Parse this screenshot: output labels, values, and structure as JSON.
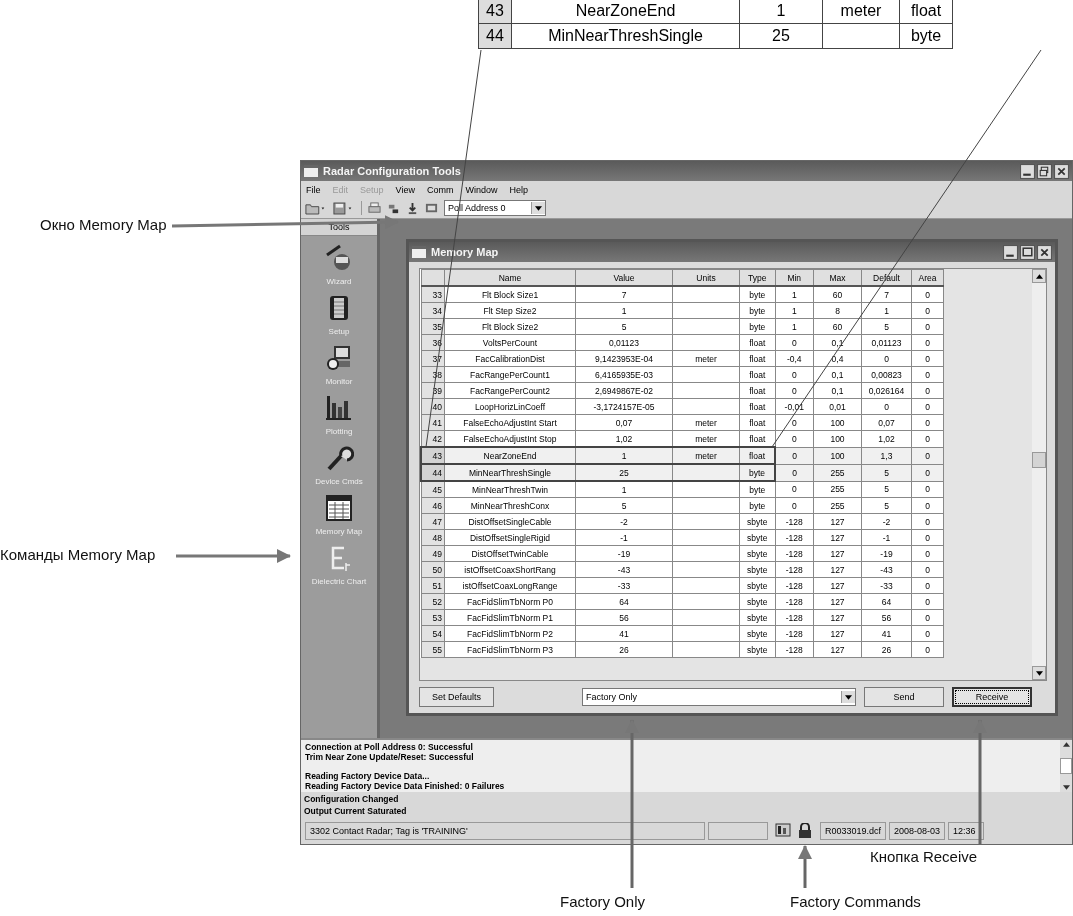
{
  "callout_table": {
    "rows": [
      {
        "cells": [
          "43",
          "NearZoneEnd",
          "1",
          "meter",
          "float"
        ]
      },
      {
        "cells": [
          "44",
          "MinNearThreshSingle",
          "25",
          "",
          "byte"
        ]
      }
    ]
  },
  "annotations": [
    {
      "text": "Окно Memory Map"
    },
    {
      "text": "Команды Memory Map"
    },
    {
      "text": "Factory Only"
    },
    {
      "text": "Factory Commands"
    },
    {
      "text": "Кнопка Receive"
    }
  ],
  "window": {
    "title": "Radar Configuration Tools",
    "menu": [
      {
        "label": "File",
        "disabled": false
      },
      {
        "label": "Edit",
        "disabled": true
      },
      {
        "label": "Setup",
        "disabled": true
      },
      {
        "label": "View",
        "disabled": false
      },
      {
        "label": "Comm",
        "disabled": false
      },
      {
        "label": "Window",
        "disabled": false
      },
      {
        "label": "Help",
        "disabled": false
      }
    ],
    "toolbar": {
      "poll_address": "Poll Address 0"
    },
    "sidebar": {
      "header": "Tools",
      "items": [
        {
          "label": "Wizard",
          "kind": "wizard"
        },
        {
          "label": "Setup",
          "kind": "setup"
        },
        {
          "label": "Monitor",
          "kind": "monitor"
        },
        {
          "label": "Plotting",
          "kind": "plotting"
        },
        {
          "label": "Device Cmds",
          "kind": "device"
        },
        {
          "label": "Memory Map",
          "kind": "memory"
        },
        {
          "label": "Dielectric Chart",
          "kind": "dielectric"
        }
      ]
    },
    "memory_map": {
      "title": "Memory Map",
      "columns": [
        "",
        "Name",
        "Value",
        "Units",
        "Type",
        "Min",
        "Max",
        "Default",
        "Area"
      ],
      "rows": [
        {
          "cells": [
            "33",
            "Flt Block Size1",
            "7",
            "",
            "byte",
            "1",
            "60",
            "7",
            "0"
          ],
          "highlighted": false
        },
        {
          "cells": [
            "34",
            "Flt Step Size2",
            "1",
            "",
            "byte",
            "1",
            "8",
            "1",
            "0"
          ],
          "highlighted": false
        },
        {
          "cells": [
            "35",
            "Flt Block Size2",
            "5",
            "",
            "byte",
            "1",
            "60",
            "5",
            "0"
          ],
          "highlighted": false
        },
        {
          "cells": [
            "36",
            "VoltsPerCount",
            "0,01123",
            "",
            "float",
            "0",
            "0,1",
            "0,01123",
            "0"
          ],
          "highlighted": false
        },
        {
          "cells": [
            "37",
            "FacCalibrationDist",
            "9,1423953E-04",
            "meter",
            "float",
            "-0,4",
            "0,4",
            "0",
            "0"
          ],
          "highlighted": false
        },
        {
          "cells": [
            "38",
            "FacRangePerCount1",
            "6,4165935E-03",
            "",
            "float",
            "0",
            "0,1",
            "0,00823",
            "0"
          ],
          "highlighted": false
        },
        {
          "cells": [
            "39",
            "FacRangePerCount2",
            "2,6949867E-02",
            "",
            "float",
            "0",
            "0,1",
            "0,026164",
            "0"
          ],
          "highlighted": false
        },
        {
          "cells": [
            "40",
            "LoopHorizLinCoeff",
            "-3,1724157E-05",
            "",
            "float",
            "-0,01",
            "0,01",
            "0",
            "0"
          ],
          "highlighted": false
        },
        {
          "cells": [
            "41",
            "FalseEchoAdjustInt Start",
            "0,07",
            "meter",
            "float",
            "0",
            "100",
            "0,07",
            "0"
          ],
          "highlighted": false
        },
        {
          "cells": [
            "42",
            "FalseEchoAdjustInt Stop",
            "1,02",
            "meter",
            "float",
            "0",
            "100",
            "1,02",
            "0"
          ],
          "highlighted": false
        },
        {
          "cells": [
            "43",
            "NearZoneEnd",
            "1",
            "meter",
            "float",
            "0",
            "100",
            "1,3",
            "0"
          ],
          "highlighted": true
        },
        {
          "cells": [
            "44",
            "MinNearThreshSingle",
            "25",
            "",
            "byte",
            "0",
            "255",
            "5",
            "0"
          ],
          "highlighted": true
        },
        {
          "cells": [
            "45",
            "MinNearThreshTwin",
            "1",
            "",
            "byte",
            "0",
            "255",
            "5",
            "0"
          ],
          "highlighted": false
        },
        {
          "cells": [
            "46",
            "MinNearThreshConx",
            "5",
            "",
            "byte",
            "0",
            "255",
            "5",
            "0"
          ],
          "highlighted": false
        },
        {
          "cells": [
            "47",
            "DistOffsetSingleCable",
            "-2",
            "",
            "sbyte",
            "-128",
            "127",
            "-2",
            "0"
          ],
          "highlighted": false
        },
        {
          "cells": [
            "48",
            "DistOffsetSingleRigid",
            "-1",
            "",
            "sbyte",
            "-128",
            "127",
            "-1",
            "0"
          ],
          "highlighted": false
        },
        {
          "cells": [
            "49",
            "DistOffsetTwinCable",
            "-19",
            "",
            "sbyte",
            "-128",
            "127",
            "-19",
            "0"
          ],
          "highlighted": false
        },
        {
          "cells": [
            "50",
            "istOffsetCoaxShortRang",
            "-43",
            "",
            "sbyte",
            "-128",
            "127",
            "-43",
            "0"
          ],
          "highlighted": false
        },
        {
          "cells": [
            "51",
            "istOffsetCoaxLongRange",
            "-33",
            "",
            "sbyte",
            "-128",
            "127",
            "-33",
            "0"
          ],
          "highlighted": false
        },
        {
          "cells": [
            "52",
            "FacFidSlimTbNorm P0",
            "64",
            "",
            "sbyte",
            "-128",
            "127",
            "64",
            "0"
          ],
          "highlighted": false
        },
        {
          "cells": [
            "53",
            "FacFidSlimTbNorm P1",
            "56",
            "",
            "sbyte",
            "-128",
            "127",
            "56",
            "0"
          ],
          "highlighted": false
        },
        {
          "cells": [
            "54",
            "FacFidSlimTbNorm P2",
            "41",
            "",
            "sbyte",
            "-128",
            "127",
            "41",
            "0"
          ],
          "highlighted": false
        },
        {
          "cells": [
            "55",
            "FacFidSlimTbNorm P3",
            "26",
            "",
            "sbyte",
            "-128",
            "127",
            "26",
            "0"
          ],
          "highlighted": false
        }
      ],
      "set_defaults": "Set Defaults",
      "mode": "Factory Only",
      "send": "Send",
      "receive": "Receive"
    },
    "log": {
      "groups": [
        [
          "Connection at Poll Address 0: Successful",
          "Trim Near Zone Update/Reset: Successful"
        ],
        [
          "Reading Factory Device Data...",
          "Reading Factory Device Data Finished: 0 Failures"
        ]
      ]
    },
    "status_messages": [
      "Configuration Changed",
      "Output Current Saturated"
    ],
    "status_bar": {
      "text": "3302 Contact Radar;  Tag is 'TRAINING'",
      "file": "R0033019.dcf",
      "date": "2008-08-03",
      "time": "12:36"
    }
  }
}
